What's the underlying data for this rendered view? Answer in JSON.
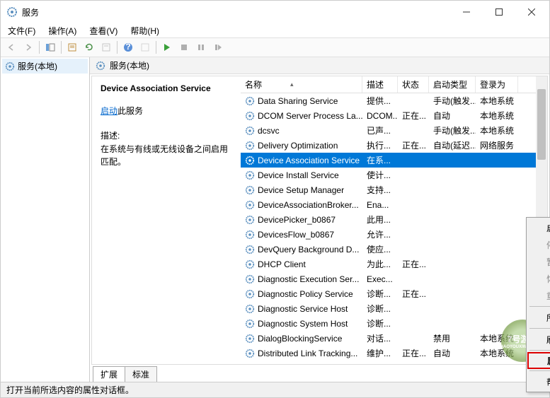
{
  "window": {
    "title": "服务"
  },
  "menubar": {
    "file": "文件(F)",
    "action": "操作(A)",
    "view": "查看(V)",
    "help": "帮助(H)"
  },
  "leftPanel": {
    "node": "服务(本地)"
  },
  "rightHeader": {
    "title": "服务(本地)"
  },
  "detail": {
    "selectedName": "Device Association Service",
    "startLink": "启动",
    "startSuffix": "此服务",
    "descLabel": "描述:",
    "descText": "在系统与有线或无线设备之间启用匹配。"
  },
  "columns": {
    "name": "名称",
    "desc": "描述",
    "status": "状态",
    "start": "启动类型",
    "logon": "登录为"
  },
  "services": [
    {
      "name": "Data Sharing Service",
      "desc": "提供...",
      "status": "",
      "start": "手动(触发...",
      "logon": "本地系统"
    },
    {
      "name": "DCOM Server Process La...",
      "desc": "DCOM...",
      "status": "正在...",
      "start": "自动",
      "logon": "本地系统"
    },
    {
      "name": "dcsvc",
      "desc": "已声...",
      "status": "",
      "start": "手动(触发...",
      "logon": "本地系统"
    },
    {
      "name": "Delivery Optimization",
      "desc": "执行...",
      "status": "正在...",
      "start": "自动(延迟...",
      "logon": "网络服务"
    },
    {
      "name": "Device Association Service",
      "desc": "在系...",
      "status": "",
      "start": "",
      "logon": "",
      "selected": true
    },
    {
      "name": "Device Install Service",
      "desc": "使计...",
      "status": "",
      "start": "",
      "logon": ""
    },
    {
      "name": "Device Setup Manager",
      "desc": "支持...",
      "status": "",
      "start": "",
      "logon": ""
    },
    {
      "name": "DeviceAssociationBroker...",
      "desc": "Ena...",
      "status": "",
      "start": "",
      "logon": ""
    },
    {
      "name": "DevicePicker_b0867",
      "desc": "此用...",
      "status": "",
      "start": "",
      "logon": ""
    },
    {
      "name": "DevicesFlow_b0867",
      "desc": "允许...",
      "status": "",
      "start": "",
      "logon": ""
    },
    {
      "name": "DevQuery Background D...",
      "desc": "使应...",
      "status": "",
      "start": "",
      "logon": ""
    },
    {
      "name": "DHCP Client",
      "desc": "为此...",
      "status": "正在...",
      "start": "",
      "logon": ""
    },
    {
      "name": "Diagnostic Execution Ser...",
      "desc": "Exec...",
      "status": "",
      "start": "",
      "logon": ""
    },
    {
      "name": "Diagnostic Policy Service",
      "desc": "诊断...",
      "status": "正在...",
      "start": "",
      "logon": ""
    },
    {
      "name": "Diagnostic Service Host",
      "desc": "诊断...",
      "status": "",
      "start": "",
      "logon": ""
    },
    {
      "name": "Diagnostic System Host",
      "desc": "诊断...",
      "status": "",
      "start": "",
      "logon": ""
    },
    {
      "name": "DialogBlockingService",
      "desc": "对话...",
      "status": "",
      "start": "禁用",
      "logon": "本地系统"
    },
    {
      "name": "Distributed Link Tracking...",
      "desc": "维护...",
      "status": "正在...",
      "start": "自动",
      "logon": "本地系统"
    }
  ],
  "contextMenu": {
    "start": "启动(S)",
    "stop": "停止(O)",
    "pause": "暂停(U)",
    "resume": "恢复(M)",
    "restart": "重新启动(E)",
    "allTasks": "所有任务(K)",
    "refresh": "刷新(F)",
    "properties": "属性(R)",
    "help": "帮助(H)"
  },
  "tabs": {
    "extended": "扩展",
    "standard": "标准"
  },
  "statusbar": {
    "text": "打开当前所选内容的属性对话框。"
  },
  "watermark": {
    "main": "7号游戏",
    "sub": "ZHAOYOUXIWANG.COM"
  }
}
